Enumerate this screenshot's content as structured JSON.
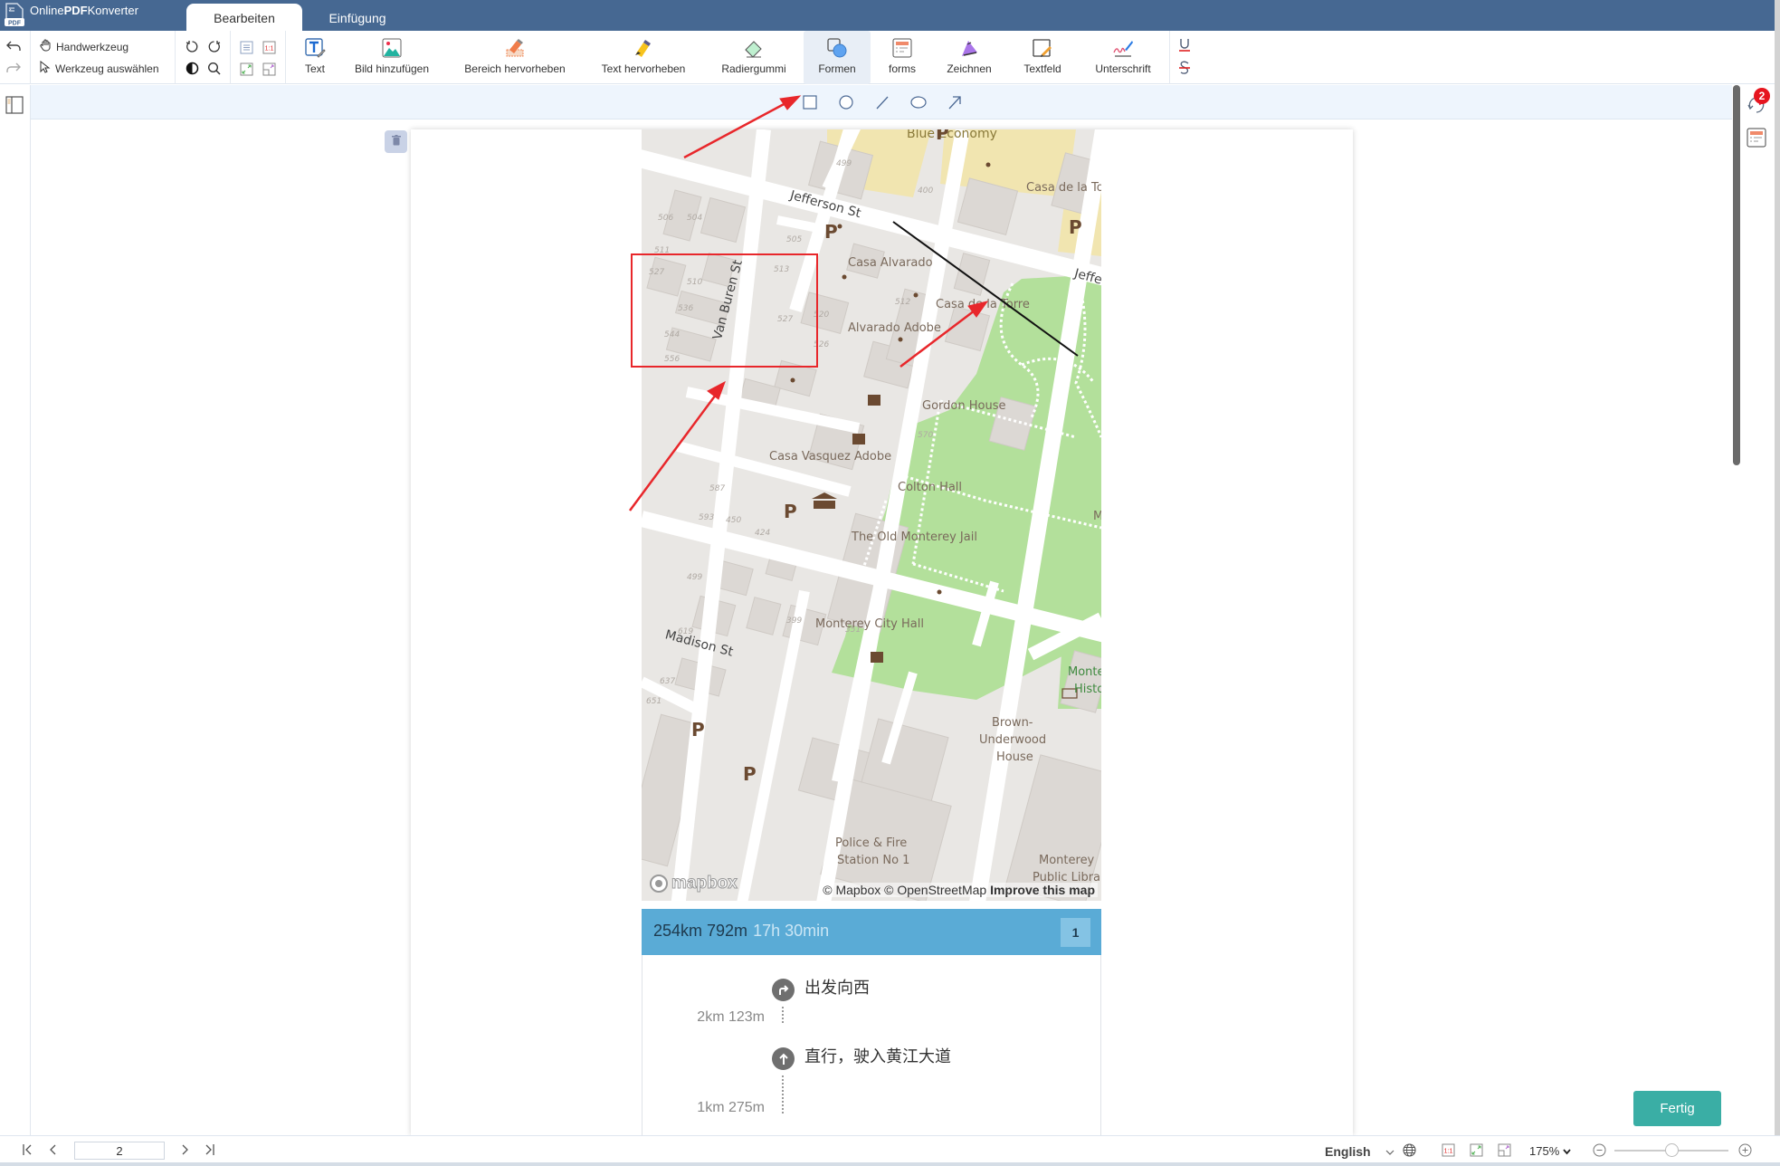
{
  "app": {
    "title_prefix": "Online",
    "title_bold": "PDF",
    "title_suffix": "Konverter",
    "logo_label": "PDF"
  },
  "tabs": [
    {
      "label": "Bearbeiten",
      "active": true
    },
    {
      "label": "Einfügung",
      "active": false
    }
  ],
  "toolbar": {
    "hand_tool": "Handwerkzeug",
    "select_tool": "Werkzeug auswählen",
    "tools": [
      {
        "label": "Text",
        "icon": "text-icon"
      },
      {
        "label": "Bild hinzufügen",
        "icon": "image-icon"
      },
      {
        "label": "Bereich hervorheben",
        "icon": "area-highlight-icon"
      },
      {
        "label": "Text hervorheben",
        "icon": "text-highlight-icon"
      },
      {
        "label": "Radiergummi",
        "icon": "eraser-icon"
      },
      {
        "label": "Formen",
        "icon": "shapes-icon",
        "active": true
      },
      {
        "label": "forms",
        "icon": "forms-icon"
      },
      {
        "label": "Zeichnen",
        "icon": "draw-icon"
      },
      {
        "label": "Textfeld",
        "icon": "textbox-icon"
      },
      {
        "label": "Unterschrift",
        "icon": "signature-icon"
      }
    ],
    "fit_label": "1:1"
  },
  "shapes": [
    "rectangle",
    "circle",
    "line",
    "ellipse",
    "arrow"
  ],
  "map": {
    "labels": {
      "blue_economy": "Blue Economy",
      "casa_de_la_torre_right": "Casa de la To",
      "jefferson": "Jefferson St",
      "jeff_right": "Jeffe",
      "casa_alvarado": "Casa Alvarado",
      "casa_de_la_torre": "Casa de la Torre",
      "alvarado_adobe": "Alvarado Adobe",
      "van_buren": "Van Buren St",
      "gordon_house": "Gordon House",
      "casa_vasquez": "Casa Vasquez Adobe",
      "colton_hall": "Colton Hall",
      "old_jail": "The Old Monterey Jail",
      "city_hall": "Monterey City Hall",
      "madison": "Madison St",
      "monte_histo_1": "Monte",
      "monte_histo_2": "Histo",
      "brown_1": "Brown-",
      "brown_2": "Underwood",
      "brown_3": "House",
      "police_1": "Police & Fire",
      "police_2": "Station No 1",
      "library_1": "Monterey",
      "library_2": "Public Librar",
      "m_right": "M"
    },
    "parking": "P",
    "house_numbers": [
      "499",
      "400",
      "506",
      "504",
      "511",
      "527",
      "510",
      "536",
      "505",
      "513",
      "512",
      "520",
      "527",
      "526",
      "544",
      "556",
      "587",
      "593",
      "450",
      "424",
      "570",
      "499",
      "399",
      "351",
      "619",
      "637",
      "651"
    ],
    "logo": "mapbox",
    "attribution": "© Mapbox © OpenStreetMap",
    "improve": "Improve this map"
  },
  "route": {
    "distance": "254km 792m",
    "duration": "17h 30min",
    "index": "1",
    "steps": [
      {
        "instruction": "出发向西",
        "distance": "2km 123m",
        "icon": "turn-right-icon"
      },
      {
        "instruction": "直行，驶入黄江大道",
        "distance": "1km 275m",
        "icon": "straight-icon"
      }
    ]
  },
  "notifications": {
    "count": "2"
  },
  "done_button": "Fertig",
  "footer": {
    "page_number": "2",
    "language": "English",
    "fit_label": "1:1",
    "zoom": "175%",
    "zoom_slider_fraction": 0.5
  },
  "colors": {
    "titlebar": "#466892",
    "accent_done": "#3aaea5",
    "route_header": "#5aabd6",
    "annotation_red": "#e8272b",
    "badge_red": "#e6151f"
  }
}
